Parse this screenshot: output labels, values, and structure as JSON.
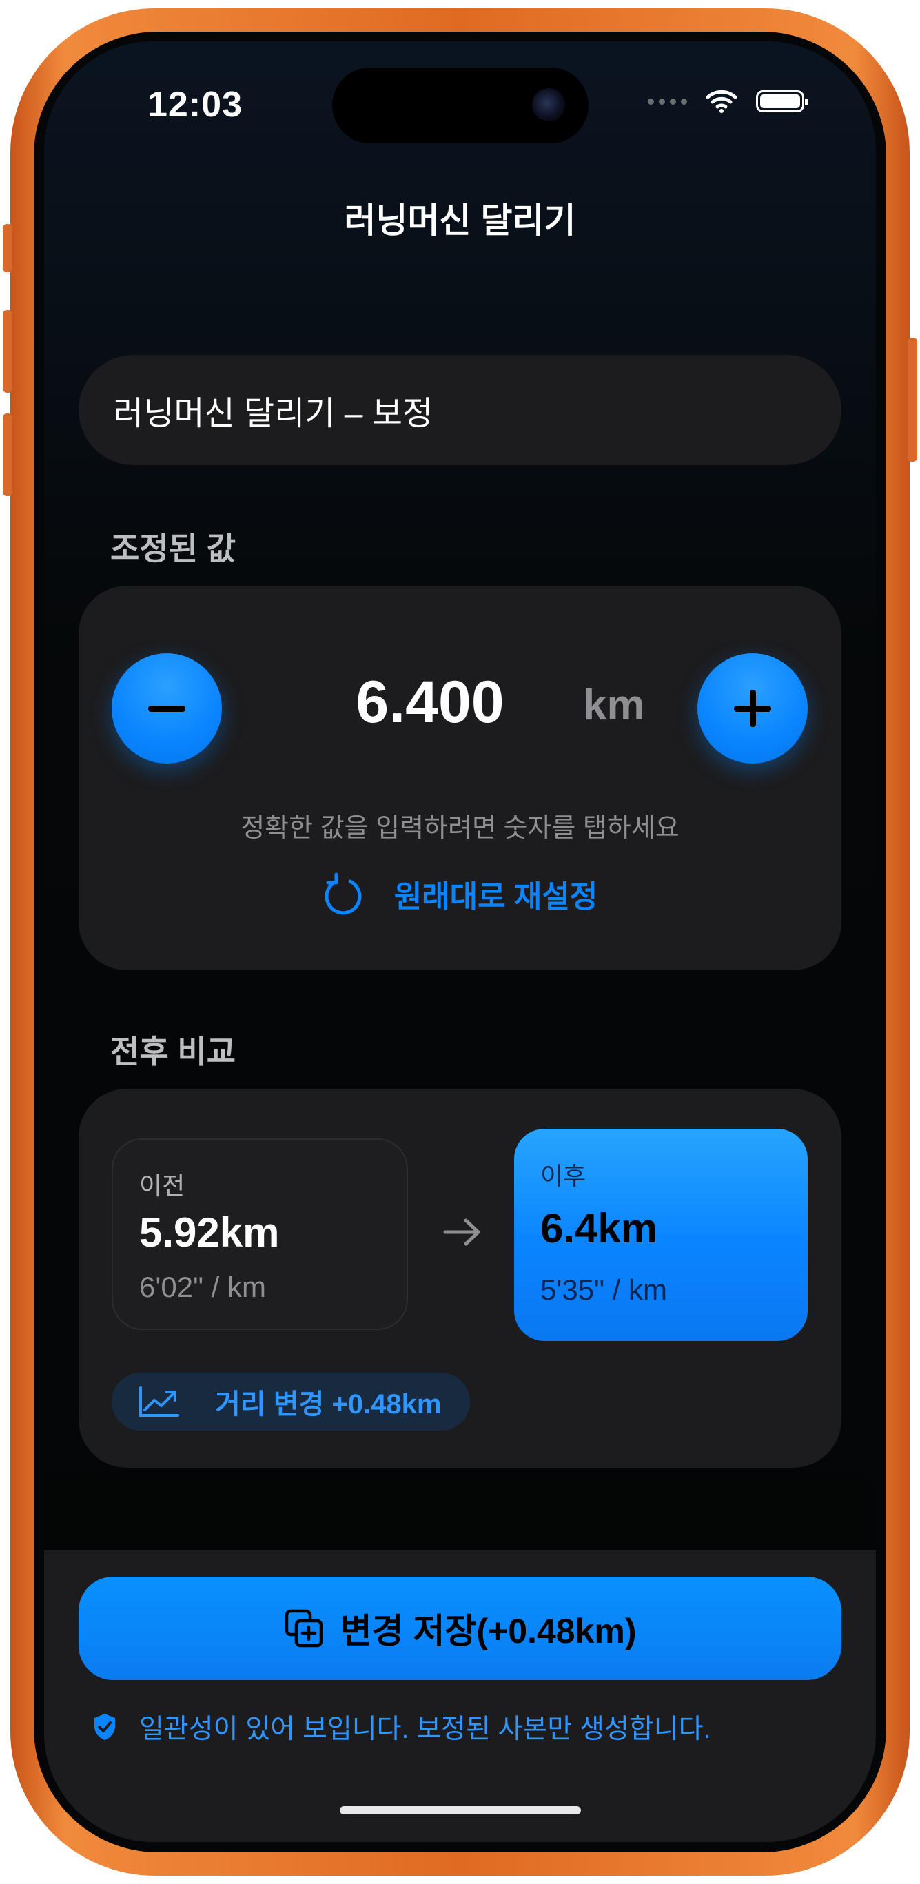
{
  "status_bar": {
    "time": "12:03"
  },
  "nav": {
    "title": "러닝머신 달리기"
  },
  "title_field": {
    "value": "러닝머신 달리기 – 보정"
  },
  "adjusted": {
    "section_label": "조정된 값",
    "value": "6.400",
    "unit": "km",
    "hint": "정확한 값을 입력하려면 숫자를 탭하세요",
    "reset_label": "원래대로 재설정"
  },
  "comparison": {
    "section_label": "전후 비교",
    "before": {
      "label": "이전",
      "distance": "5.92km",
      "pace": "6'02\" / km"
    },
    "after": {
      "label": "이후",
      "distance": "6.4km",
      "pace": "5'35\" / km"
    },
    "delta_label": "거리 변경 +0.48km"
  },
  "footer": {
    "save_label": "변경 저장(+0.48km)",
    "note": "일관성이 있어 보입니다. 보정된 사본만 생성합니다."
  },
  "colors": {
    "accent": "#0a84ff",
    "frame": "#e06a22",
    "card": "#1c1c1e"
  },
  "icons": [
    "minus-icon",
    "plus-icon",
    "reset-icon",
    "arrow-right-icon",
    "trend-up-icon",
    "duplicate-plus-icon",
    "shield-check-icon",
    "wifi-icon",
    "battery-icon"
  ]
}
